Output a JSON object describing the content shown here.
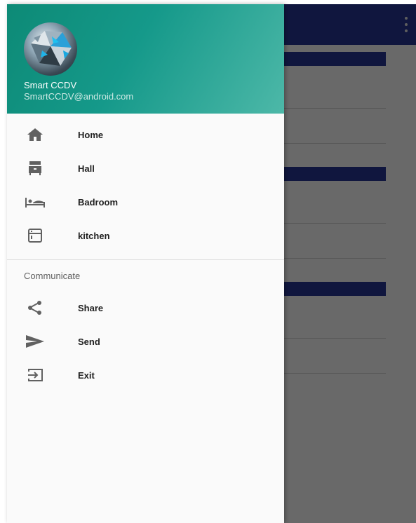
{
  "drawer_header": {
    "user_name": "Smart CCDV",
    "user_email": "SmartCCDV@android.com"
  },
  "menu_items": [
    {
      "label": "Home",
      "icon": "home-icon"
    },
    {
      "label": "Hall",
      "icon": "hall-icon"
    },
    {
      "label": "Badroom",
      "icon": "bed-icon"
    },
    {
      "label": "kitchen",
      "icon": "kitchen-icon"
    }
  ],
  "communicate": {
    "header": "Communicate",
    "items": [
      {
        "label": "Share",
        "icon": "share-icon"
      },
      {
        "label": "Send",
        "icon": "send-icon"
      },
      {
        "label": "Exit",
        "icon": "exit-icon"
      }
    ]
  },
  "colors": {
    "app_bar": "#283593",
    "drawer_header": "#15998a",
    "icon": "#616161"
  }
}
